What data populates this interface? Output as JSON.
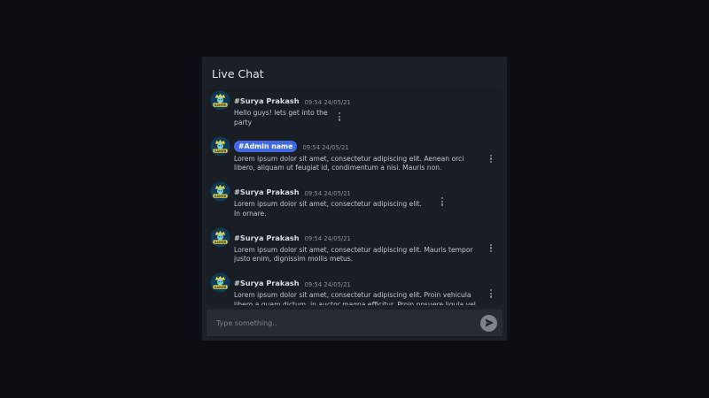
{
  "chat": {
    "title": "Live Chat",
    "messages": [
      {
        "username": "#Surya Prakash",
        "is_admin": false,
        "timestamp": "09:54 24/05/21",
        "text": "Hello guys! lets get into the party"
      },
      {
        "username": "#Admin name",
        "is_admin": true,
        "timestamp": "09:54 24/05/21",
        "text": "Lorem ipsum dolor sit amet, consectetur adipiscing elit. Aenean orci libero, aliquam ut feugiat id, condimentum a nisi. Mauris non."
      },
      {
        "username": "#Surya Prakash",
        "is_admin": false,
        "timestamp": "09:54 24/05/21",
        "text": "Lorem ipsum dolor sit amet, consectetur adipiscing elit. In ornare."
      },
      {
        "username": "#Surya Prakash",
        "is_admin": false,
        "timestamp": "09:54 24/05/21",
        "text": "Lorem ipsum dolor sit amet, consectetur adipiscing elit. Mauris tempor justo enim, dignissim mollis metus."
      },
      {
        "username": "#Surya Prakash",
        "is_admin": false,
        "timestamp": "09:54 24/05/21",
        "text": "Lorem ipsum dolor sit amet, consectetur adipiscing elit. Proin vehicula libero a quam dictum, in auctor magna efficitur. Proin posuere ligula vel augue"
      }
    ],
    "composer": {
      "placeholder": "Type something.."
    },
    "avatar": {
      "icon": "gamer-logo-icon",
      "label": "GAMER"
    }
  },
  "colors": {
    "page_background": "#0b0e13",
    "panel_background": "#1b1f27",
    "admin_badge": "#4169e1",
    "send_button": "#7f848c"
  }
}
